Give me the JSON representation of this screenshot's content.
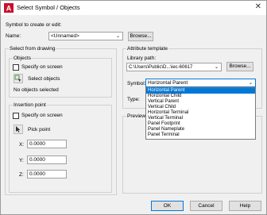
{
  "window": {
    "title": "Select Symbol / Objects",
    "close_glyph": "✕"
  },
  "header": {
    "prompt": "Symbol to create or edit:",
    "name_label": "Name:",
    "name_value": "<Unnamed>",
    "browse_label": "Browse..."
  },
  "select_from_drawing": {
    "title": "Select from drawing",
    "objects": {
      "title": "Objects",
      "specify_on_screen": "Specify on screen",
      "select_objects": "Select objects",
      "status": "No objects selected"
    },
    "insertion": {
      "title": "Insertion point",
      "specify_on_screen": "Specify on screen",
      "pick_point": "Pick point",
      "x_label": "X:",
      "x_value": "0.0000",
      "y_label": "Y:",
      "y_value": "0.0000",
      "z_label": "Z:",
      "z_value": "0.0000"
    }
  },
  "attribute_template": {
    "title": "Attribute template",
    "library_label": "Library path:",
    "library_value": "C:\\Users\\Public\\D...\\iec-60617",
    "browse_label": "Browse...",
    "symbol_label": "Symbol:",
    "symbol_value": "Horizontal Parent",
    "type_label": "Type:",
    "options": [
      "Horizontal Parent",
      "Horizontal Child",
      "Vertical Parent",
      "Vertical Child",
      "Horizontal Terminal",
      "Vertical Terminal",
      "Panel Footprint",
      "Panel Nameplate",
      "Panel Terminal"
    ]
  },
  "preview": {
    "title": "Preview"
  },
  "footer": {
    "ok": "OK",
    "cancel": "Cancel",
    "help": "Help"
  }
}
